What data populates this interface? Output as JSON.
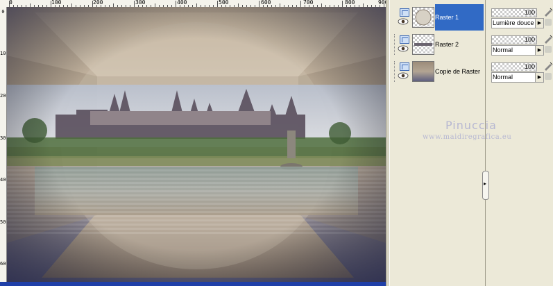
{
  "ruler": {
    "top_labels": [
      "0",
      "100",
      "200",
      "300",
      "400",
      "500",
      "600",
      "700",
      "800",
      "900"
    ],
    "left_labels": [
      "0",
      "100",
      "200",
      "300",
      "400",
      "500",
      "600"
    ]
  },
  "layers": [
    {
      "name": "Raster 1",
      "selected": true
    },
    {
      "name": "Raster 2",
      "selected": false
    },
    {
      "name": "Copie de Raster",
      "selected": false
    }
  ],
  "properties": [
    {
      "opacity": "100",
      "blend": "Lumière douce"
    },
    {
      "opacity": "100",
      "blend": "Normal"
    },
    {
      "opacity": "100",
      "blend": "Normal"
    }
  ],
  "watermark": {
    "title": "Pinuccia",
    "site": "www.maidiregrafica.eu"
  },
  "colors": {
    "selection": "#316AC5",
    "panel": "#ECE9D8",
    "scrollbar": "#1F3FA8"
  }
}
